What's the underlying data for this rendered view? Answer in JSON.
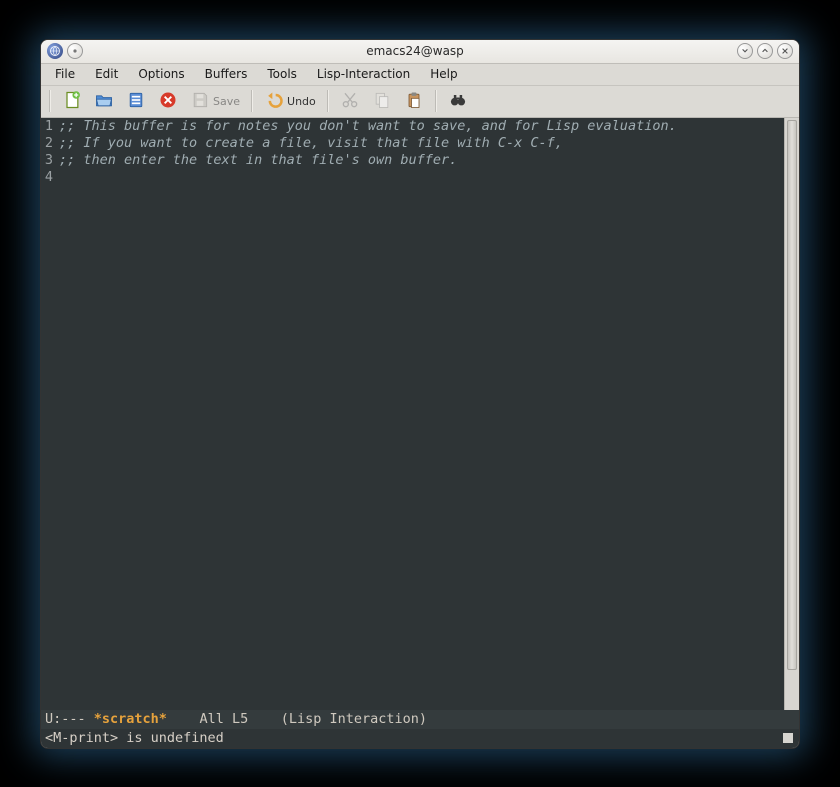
{
  "window": {
    "title": "emacs24@wasp"
  },
  "menubar": {
    "items": [
      "File",
      "Edit",
      "Options",
      "Buffers",
      "Tools",
      "Lisp-Interaction",
      "Help"
    ]
  },
  "toolbar": {
    "save_label": "Save",
    "undo_label": "Undo"
  },
  "buffer": {
    "lines": [
      ";; This buffer is for notes you don't want to save, and for Lisp evaluation.",
      ";; If you want to create a file, visit that file with C-x C-f,",
      ";; then enter the text in that file's own buffer.",
      ""
    ],
    "line_numbers": [
      "1",
      "2",
      "3",
      "4"
    ]
  },
  "modeline": {
    "prefix": "U:--- ",
    "buffer_name": "*scratch*",
    "position": "    All L5    ",
    "mode": "(Lisp Interaction)"
  },
  "minibuffer": {
    "message": "<M-print> is undefined"
  }
}
